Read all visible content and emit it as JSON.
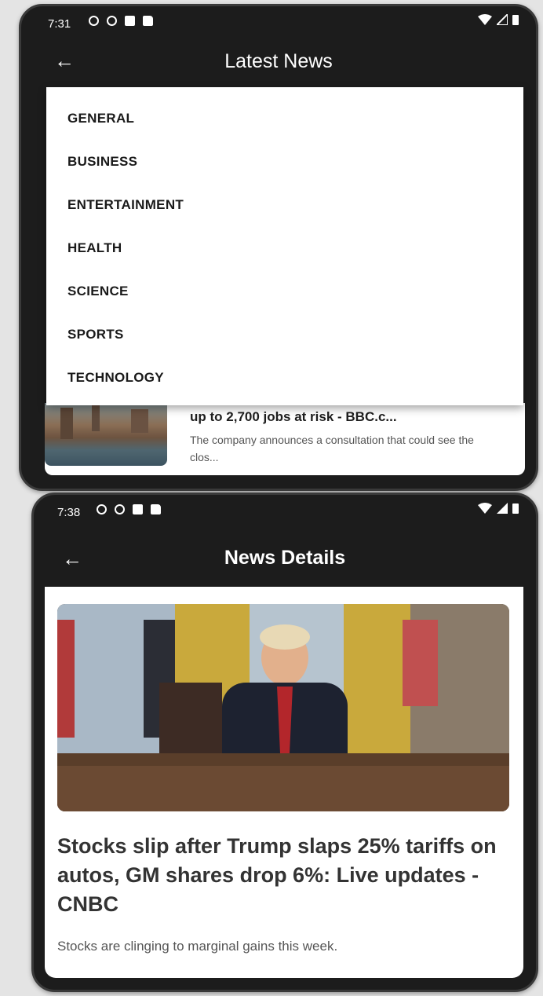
{
  "screen1": {
    "status": {
      "time": "7:31"
    },
    "appbar": {
      "title": "Latest News"
    },
    "menu": {
      "items": [
        "GENERAL",
        "BUSINESS",
        "ENTERTAINMENT",
        "HEALTH",
        "SCIENCE",
        "SPORTS",
        "TECHNOLOGY"
      ]
    },
    "card": {
      "title": "up to 2,700 jobs at risk - BBC.c...",
      "description": "The company announces a consultation that could see the clos..."
    }
  },
  "screen2": {
    "status": {
      "time": "7:38"
    },
    "appbar": {
      "title": "News Details"
    },
    "article": {
      "title": "Stocks slip after Trump slaps 25% tariffs on autos, GM shares drop 6%: Live updates - CNBC",
      "description": "Stocks are clinging to marginal gains this week."
    }
  },
  "colors": {
    "appbar_bg": "#1c1c1c",
    "page_bg": "#e4e4e4",
    "surface": "#ffffff"
  }
}
